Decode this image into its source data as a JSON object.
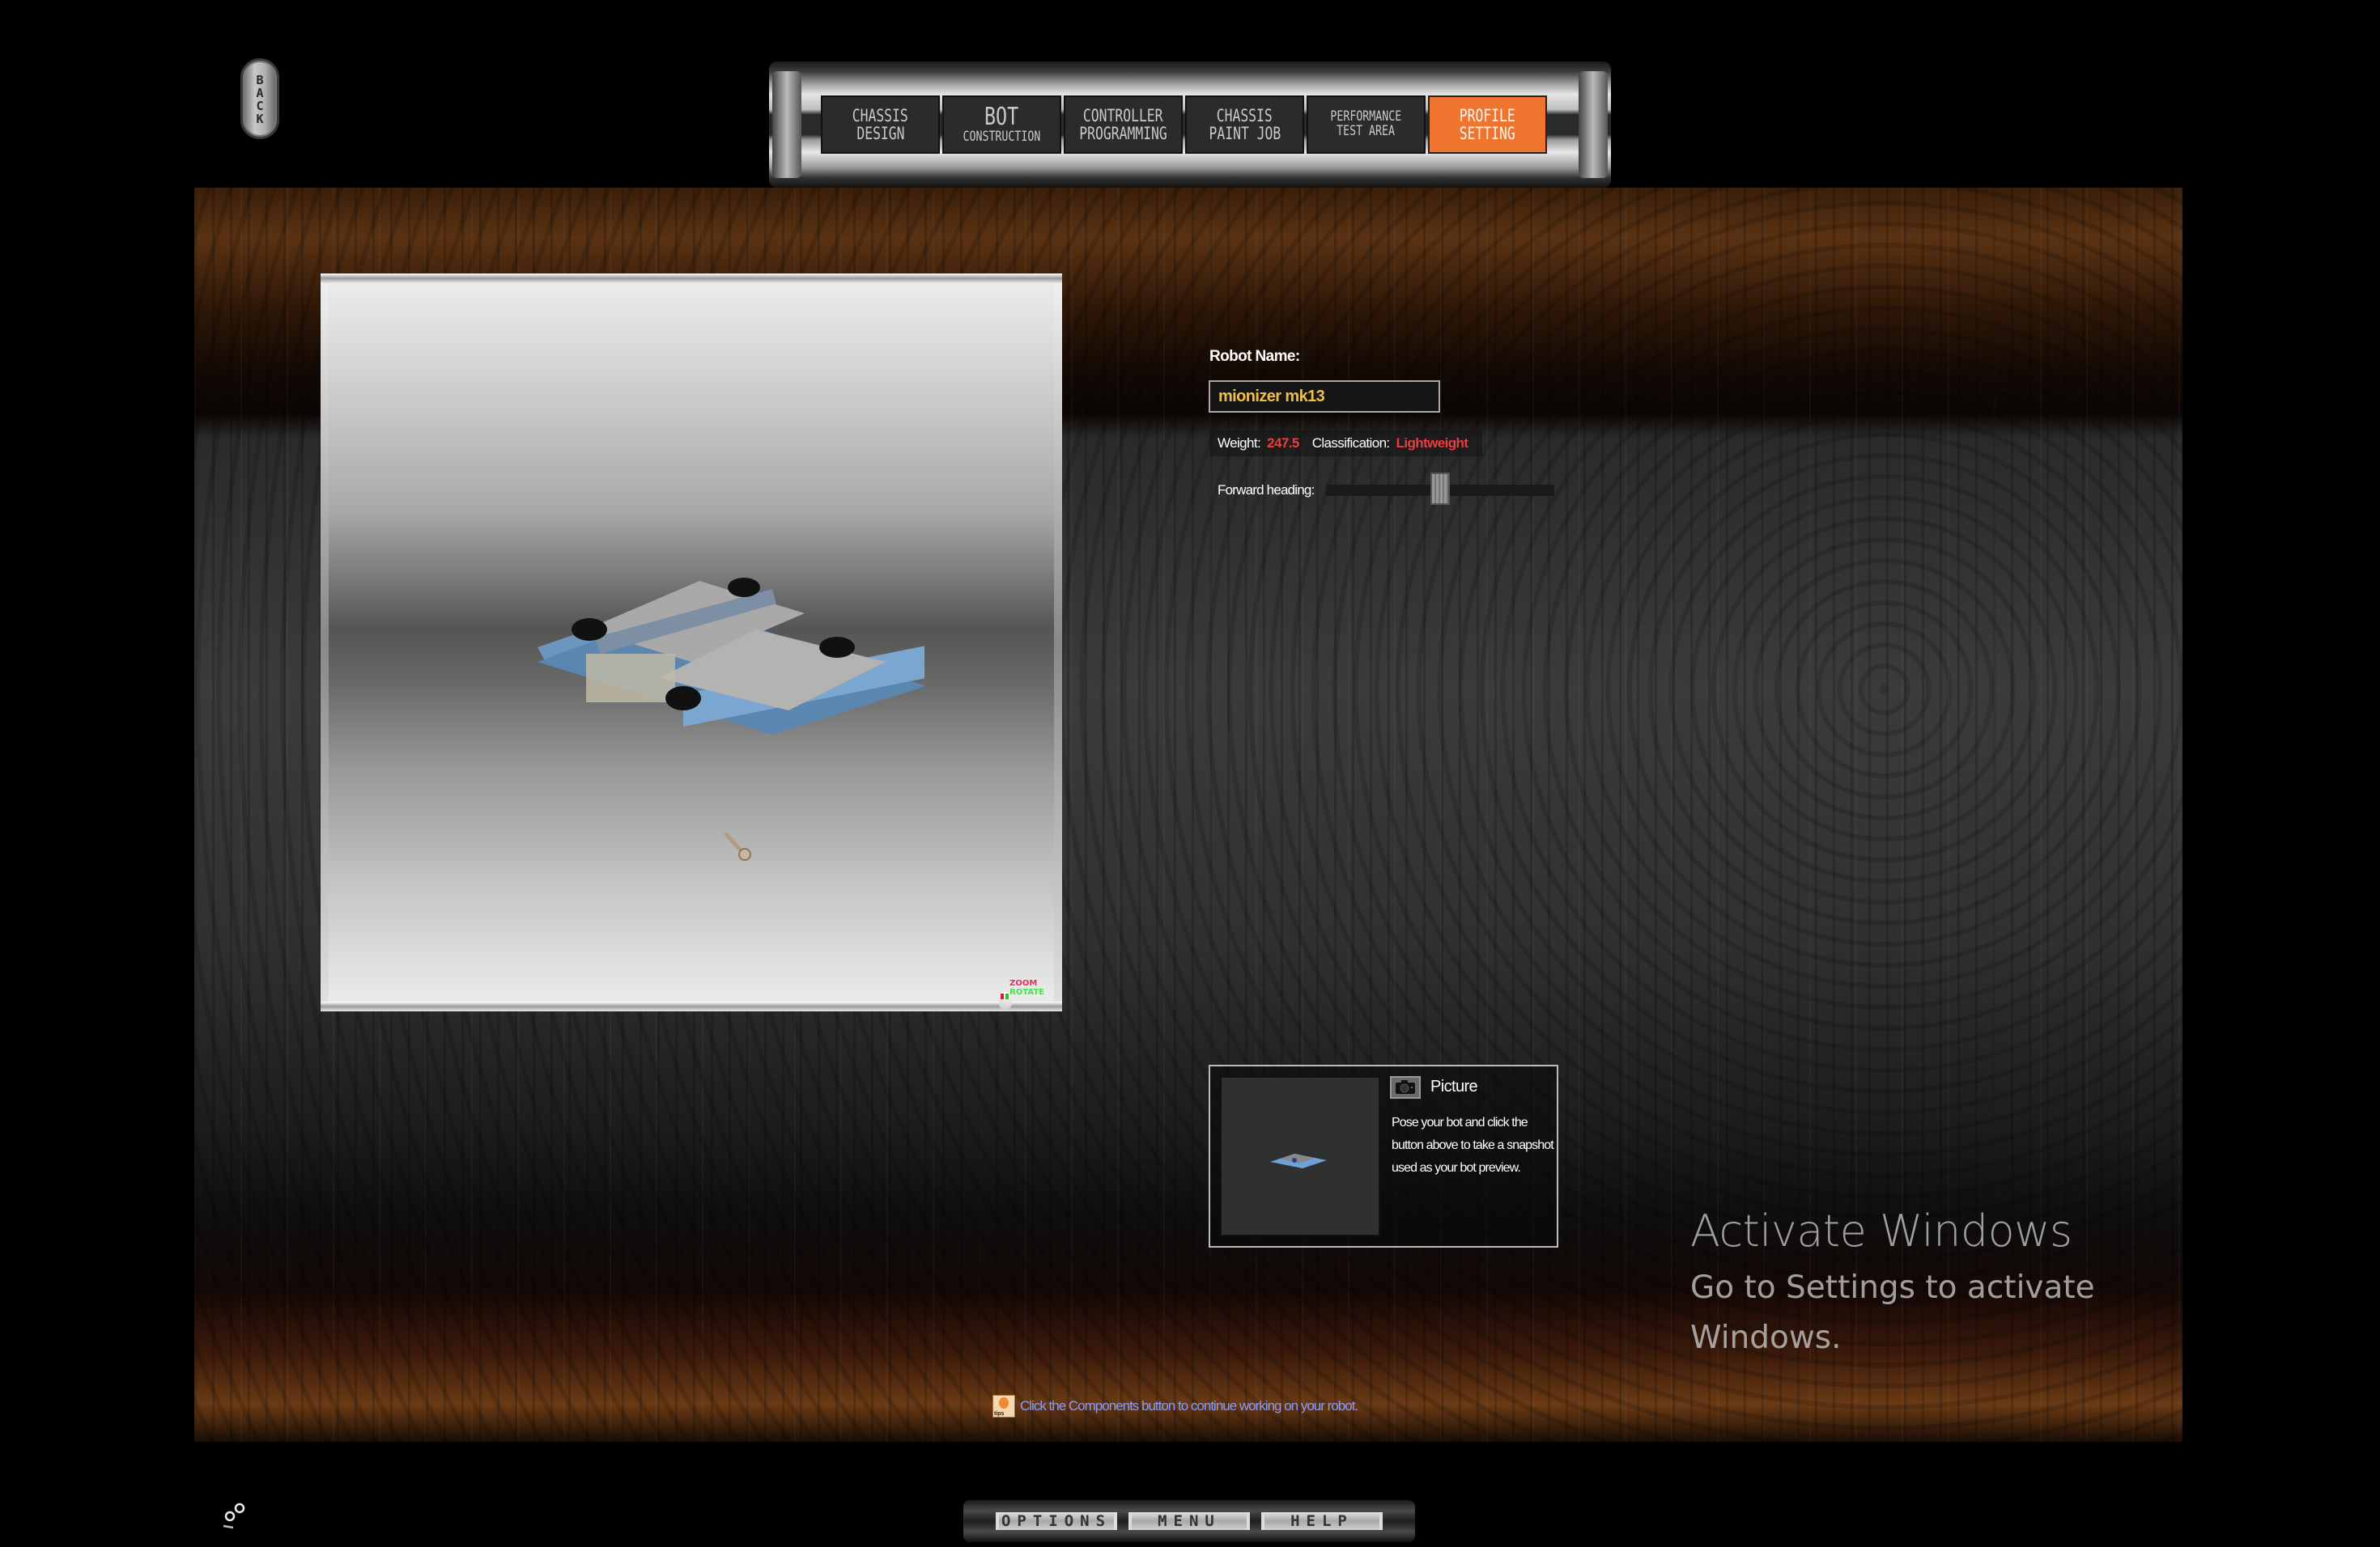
{
  "back_button": {
    "label": "BACK"
  },
  "nav": {
    "tabs": [
      {
        "line1": "Chassis",
        "line2": "Design",
        "style": "normal",
        "active": false
      },
      {
        "line1": "Bot",
        "line2": "Construction",
        "style": "big",
        "active": false
      },
      {
        "line1": "Controller",
        "line2": "Programming",
        "style": "normal",
        "active": false
      },
      {
        "line1": "Chassis",
        "line2": "Paint Job",
        "style": "normal",
        "active": false
      },
      {
        "line1": "Performance",
        "line2": "Test Area",
        "style": "small",
        "active": false
      },
      {
        "line1": "Profile",
        "line2": "Setting",
        "style": "normal",
        "active": true
      }
    ],
    "active_color": "#ee7430"
  },
  "viewport": {
    "zoom_hint": "ZOOM",
    "rotate_hint": "ROTATE"
  },
  "profile": {
    "robot_name_label": "Robot Name:",
    "robot_name_value": "mionizer mk13",
    "weight_label": "Weight:",
    "weight_value": "247.5",
    "classification_label": "Classification:",
    "classification_value": "Lightweight",
    "forward_heading_label": "Forward heading:",
    "forward_heading_position_fraction": 0.5,
    "value_color": "#ee3b3b",
    "name_color": "#f0bf4a"
  },
  "picture": {
    "title": "Picture",
    "description": "Pose your bot and click the button above to take a snapshot used as your bot preview."
  },
  "tip": {
    "text": "Click the Components button to continue working on your robot.",
    "color": "#8c9cf4"
  },
  "watermark": {
    "title": "Activate Windows",
    "subtitle": "Go to Settings to activate Windows."
  },
  "bottom_bar": {
    "options_label": "OPTIONS",
    "menu_label": "MENU",
    "help_label": "HELP"
  }
}
